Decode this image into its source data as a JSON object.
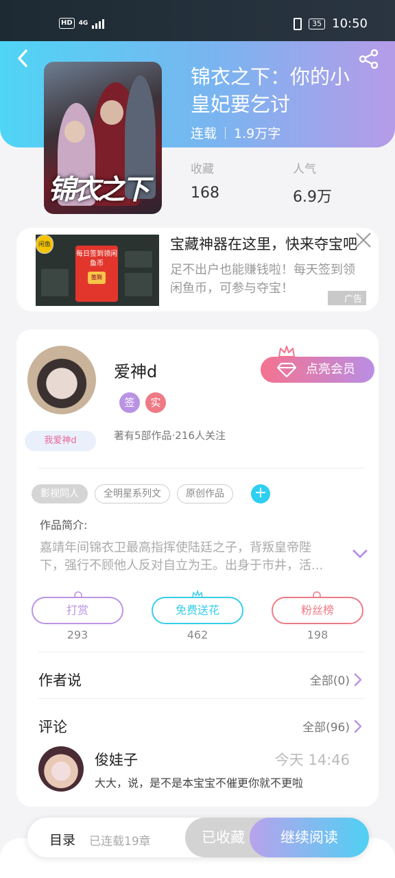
{
  "status_bar": {
    "hd": "HD",
    "network": "4G",
    "battery": "35",
    "time": "10:50"
  },
  "book": {
    "title": "锦衣之下：你的小皇妃要乞讨",
    "status": "连载",
    "word_count": "1.9万字",
    "cover_text": "锦衣之下",
    "stats": {
      "favorites_label": "收藏",
      "favorites_value": "168",
      "popularity_label": "人气",
      "popularity_value": "6.9万"
    }
  },
  "ad": {
    "title": "宝藏神器在这里，快来夺宝吧",
    "description": "足不出户也能赚钱啦！每天签到领闲鱼币，可参与夺宝！",
    "badge": "广告",
    "image_tag": "闲鱼",
    "image_card_title": "每日签到领闲鱼币",
    "image_card_button": "签到"
  },
  "author": {
    "name": "爱神d",
    "tag": "我爱神d",
    "badge_sign": "签",
    "badge_real": "实",
    "stats": "著有5部作品·216人关注",
    "vip_button": "点亮会员"
  },
  "tags": [
    "影视同人",
    "全明星系列文",
    "原创作品"
  ],
  "add_tag": "+",
  "intro": {
    "label": "作品简介:",
    "text": "嘉靖年间锦衣卫最高指挥使陆廷之子，背叛皇帝陛下，强行不顾他人反对自立为王。出身于市井，活..."
  },
  "actions": [
    {
      "label": "打赏",
      "count": "293",
      "color": "#b993e3"
    },
    {
      "label": "免费送花",
      "count": "462",
      "color": "#35cde9"
    },
    {
      "label": "粉丝榜",
      "count": "198",
      "color": "#ee7a86"
    }
  ],
  "author_says": {
    "title": "作者说",
    "link": "全部(0)"
  },
  "comments": {
    "title": "评论",
    "link": "全部(96)",
    "first": {
      "user": "俊娃子",
      "time": "今天 14:46",
      "text": "大大，说，是不是本宝宝不催更你就不更啦"
    }
  },
  "bottom": {
    "toc": "目录",
    "toc_sub": "已连载19章",
    "favorited": "已收藏",
    "read": "继续阅读"
  }
}
